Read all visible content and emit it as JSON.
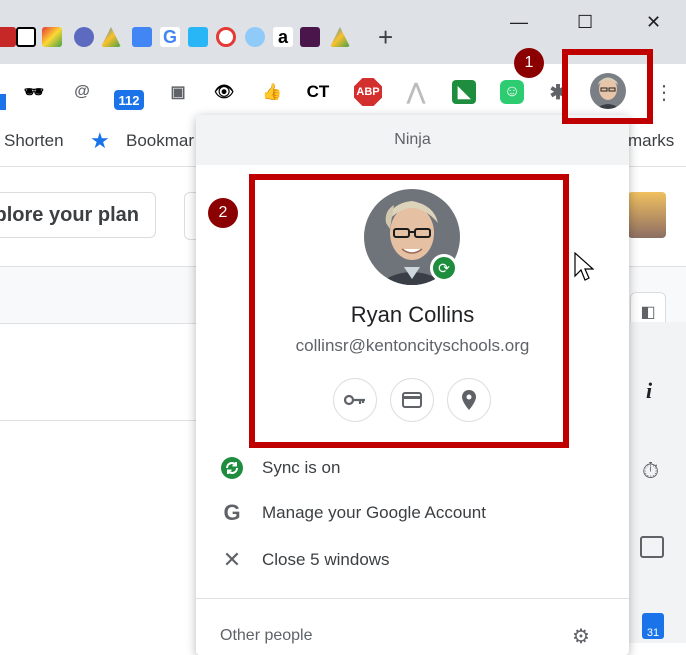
{
  "window": {
    "new_tab_glyph": "+",
    "minimize_glyph": "—",
    "maximize_glyph": "☐",
    "close_glyph": "✕"
  },
  "toolbar": {
    "extensions": {
      "badge_count": "112",
      "ct_label": "CT",
      "abp_label": "ABP"
    }
  },
  "bookmarks": {
    "items": [
      {
        "label": "Shorten"
      },
      {
        "label": "Bookmar"
      },
      {
        "label": "marks"
      }
    ]
  },
  "page": {
    "plan_button": "plore your plan"
  },
  "profile_menu": {
    "header": "Ninja",
    "name": "Ryan Collins",
    "email": "collinsr@kentoncityschools.org",
    "quick_actions": [
      "passwords-key-icon",
      "payment-card-icon",
      "addresses-pin-icon"
    ],
    "items": [
      {
        "label": "Sync is on",
        "icon": "sync-icon"
      },
      {
        "label": "Manage your Google Account",
        "icon": "google-g-icon"
      },
      {
        "label": "Close 5 windows",
        "icon": "close-x-icon"
      }
    ],
    "other_people_label": "Other people"
  },
  "annotations": {
    "callout_1": "1",
    "callout_2": "2",
    "highlight_color": "#c00000"
  },
  "colors": {
    "sync_green": "#1e8e3e",
    "callout_red": "#8b0000"
  }
}
